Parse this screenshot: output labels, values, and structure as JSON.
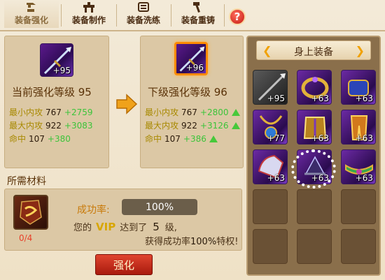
{
  "tabs": [
    {
      "label": "装备强化",
      "icon": "anvil-icon",
      "active": true
    },
    {
      "label": "装备制作",
      "icon": "workbench-icon",
      "active": false
    },
    {
      "label": "装备洗练",
      "icon": "scroll-icon",
      "active": false
    },
    {
      "label": "装备重铸",
      "icon": "hammer-icon",
      "active": false
    }
  ],
  "help": {
    "label": "?"
  },
  "current": {
    "item_level": "+95",
    "title": "当前强化等级 95",
    "stats": [
      {
        "name": "最小内攻",
        "value": "767",
        "inc": "+2759"
      },
      {
        "name": "最大内攻",
        "value": "922",
        "inc": "+3083"
      },
      {
        "name": "命中",
        "value": "107",
        "inc": "+380"
      }
    ]
  },
  "next": {
    "item_level": "+96",
    "title": "下级强化等级 96",
    "stats": [
      {
        "name": "最小内攻",
        "value": "767",
        "inc": "+2800"
      },
      {
        "name": "最大内攻",
        "value": "922",
        "inc": "+3126"
      },
      {
        "name": "命中",
        "value": "107",
        "inc": "+386"
      }
    ]
  },
  "materials": {
    "title": "所需材料",
    "count": "0/4",
    "rate_label": "成功率:",
    "rate_value": "100%",
    "vip_prefix": "您的",
    "vip_text": "VIP",
    "vip_mid": "达到了",
    "vip_level": "5",
    "vip_suffix": "级,",
    "bonus_prefix": "获得成功率",
    "bonus_pct": "100%",
    "bonus_suffix": "特权!"
  },
  "action": {
    "label": "强化"
  },
  "equipment": {
    "title": "身上装备",
    "slots": [
      {
        "level": "+95",
        "style": "gray",
        "icon": "weapon-icon"
      },
      {
        "level": "+63",
        "style": "purple",
        "icon": "ring-icon"
      },
      {
        "level": "+63",
        "style": "purple",
        "icon": "bracer-icon"
      },
      {
        "level": "+77",
        "style": "purple",
        "icon": "necklace-icon"
      },
      {
        "level": "+63",
        "style": "purple",
        "icon": "armor-icon"
      },
      {
        "level": "+63",
        "style": "purple",
        "icon": "leggings-icon"
      },
      {
        "level": "+63",
        "style": "purple",
        "icon": "shoulder-icon"
      },
      {
        "level": "+63",
        "style": "purple",
        "icon": "hat-icon"
      },
      {
        "level": "+63",
        "style": "purple",
        "icon": "belt-icon"
      },
      {
        "level": "",
        "style": "empty",
        "icon": ""
      },
      {
        "level": "",
        "style": "empty",
        "icon": ""
      },
      {
        "level": "",
        "style": "empty",
        "icon": ""
      },
      {
        "level": "",
        "style": "empty",
        "icon": ""
      },
      {
        "level": "",
        "style": "empty",
        "icon": ""
      },
      {
        "level": "",
        "style": "empty",
        "icon": ""
      }
    ]
  },
  "colors": {
    "accent": "#f1a100",
    "increase": "#3cc43a",
    "stat_name": "#a88900"
  }
}
